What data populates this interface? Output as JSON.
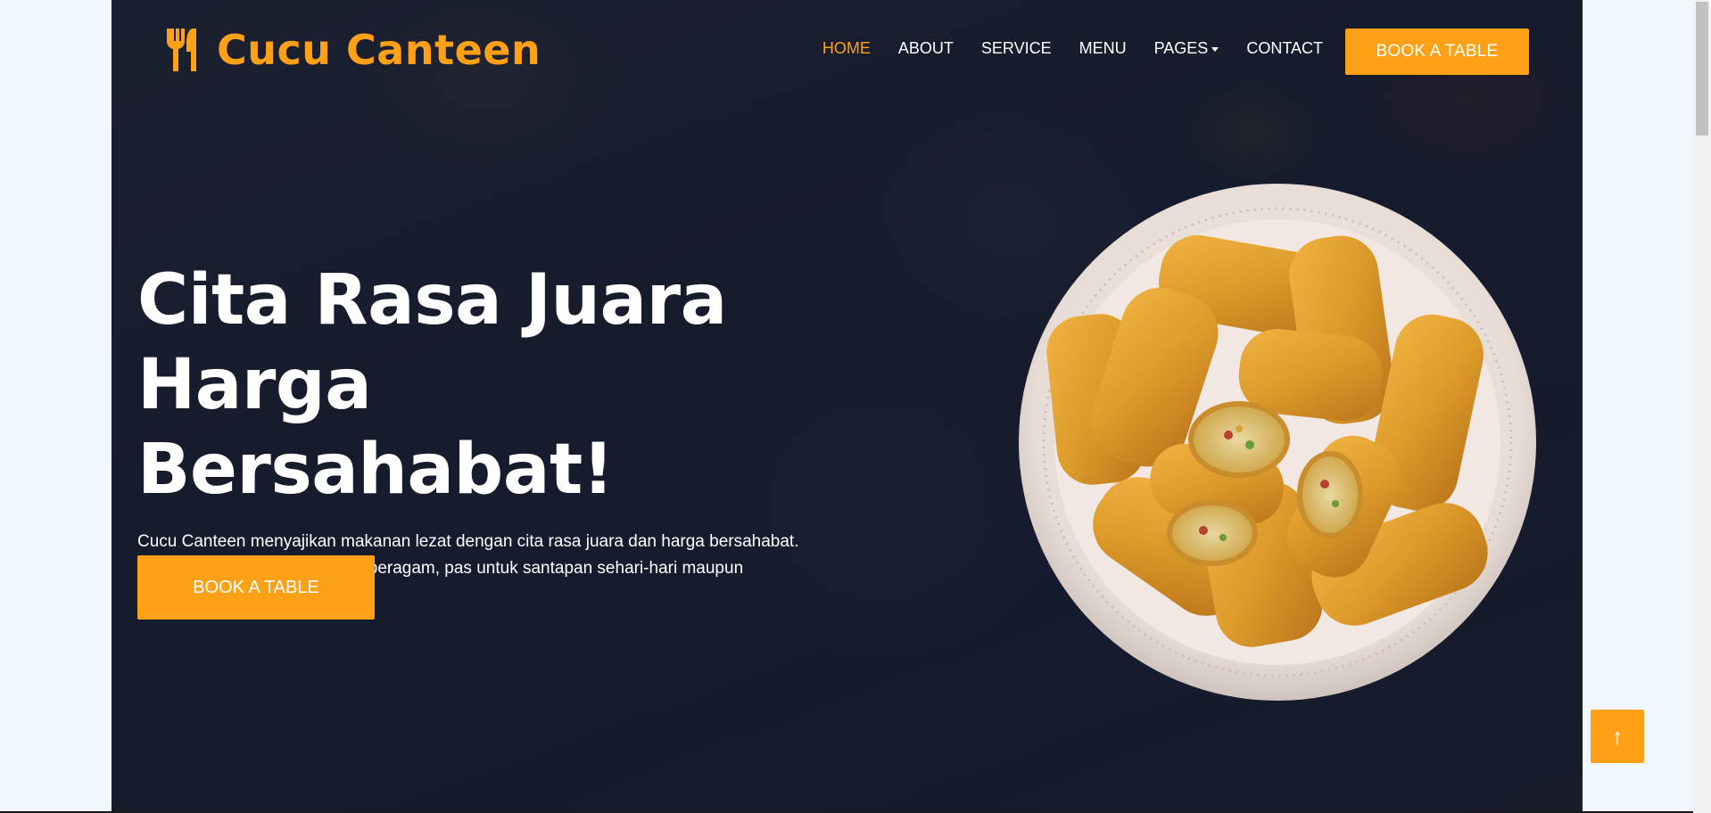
{
  "brand": {
    "name": "Cucu Canteen",
    "icon": "utensils-icon",
    "color": "#fea116"
  },
  "nav": {
    "items": [
      {
        "label": "HOME",
        "active": true
      },
      {
        "label": "ABOUT",
        "active": false
      },
      {
        "label": "SERVICE",
        "active": false
      },
      {
        "label": "MENU",
        "active": false
      },
      {
        "label": "PAGES",
        "active": false,
        "has_dropdown": true
      },
      {
        "label": "CONTACT",
        "active": false
      }
    ],
    "cta_label": "BOOK A TABLE"
  },
  "hero": {
    "headline_line1": "Cita Rasa Juara",
    "headline_line2": "Harga Bersahabat!",
    "subtitle": "Cucu Canteen menyajikan makanan lezat dengan cita rasa juara dan harga bersahabat. Tempat nyaman, pilihan menu beragam, pas untuk santapan sehari-hari maupun nongkrong santai!",
    "cta_label": "BOOK A TABLE",
    "image": "plate-of-fried-rolls"
  },
  "back_to_top": {
    "icon": "arrow-up-icon",
    "glyph": "↑"
  },
  "colors": {
    "accent": "#fea116",
    "overlay": "#0f172b",
    "page_background": "#f0f6fd"
  }
}
